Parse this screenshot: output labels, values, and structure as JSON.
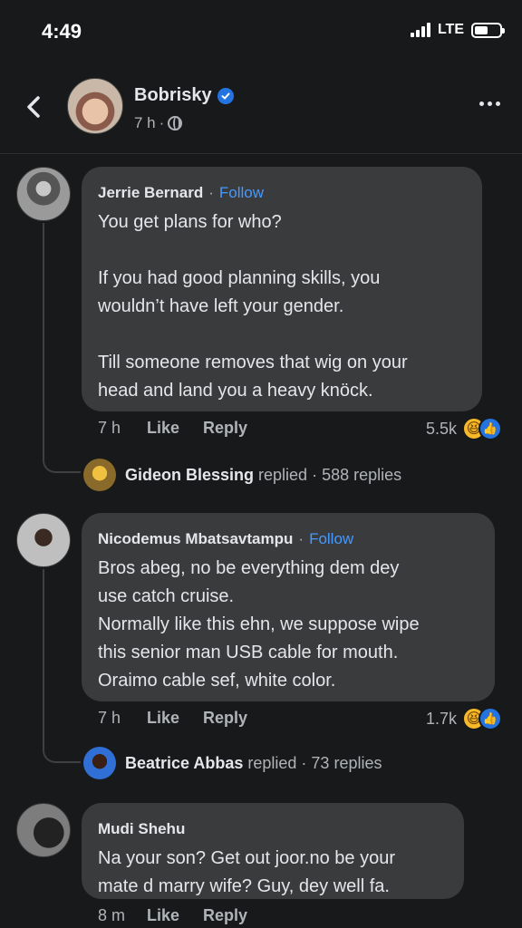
{
  "status": {
    "time": "4:49",
    "network": "LTE",
    "battery_level": 0.55
  },
  "post": {
    "author": "Bobrisky",
    "time": "7 h",
    "dot": "·",
    "icons": {
      "back": "chevron-left-icon",
      "verified": "verified-badge-icon",
      "privacy": "globe-icon",
      "more": "more-horizontal-icon"
    }
  },
  "comments": [
    {
      "name": "Jerrie Bernard",
      "follow": "Follow",
      "lines": [
        "You get plans for who?",
        "",
        "If you had good planning skills, you",
        "wouldn’t have left your gender.",
        "",
        "Till someone removes that wig on your",
        "head and land you a heavy knöck."
      ],
      "age": "7 h",
      "like": "Like",
      "reply": "Reply",
      "reactions": "5.5k",
      "replied_by": "Gideon Blessing",
      "replied_suffix": " replied · 588 replies"
    },
    {
      "name": "Nicodemus Mbatsavtampu",
      "follow": "Follow",
      "lines": [
        "Bros abeg, no be everything dem dey",
        "use catch cruise.",
        "Normally like this ehn, we suppose wipe",
        "this senior man  USB cable for mouth.",
        "Oraimo cable sef, white color."
      ],
      "age": "7 h",
      "like": "Like",
      "reply": "Reply",
      "reactions": "1.7k",
      "replied_by": "Beatrice Abbas",
      "replied_suffix": " replied · 73 replies"
    },
    {
      "name": "Mudi Shehu",
      "lines": [
        "Na your son? Get out joor.no be your",
        "mate d marry wife? Guy, dey well fa."
      ],
      "age": "8 m",
      "like": "Like",
      "reply": "Reply"
    }
  ]
}
